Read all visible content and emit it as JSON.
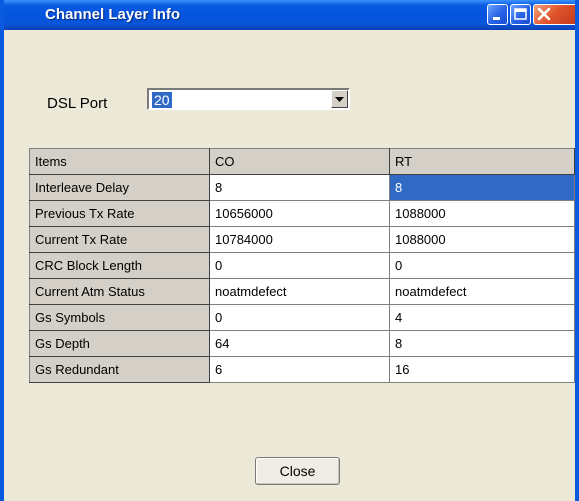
{
  "window": {
    "title": "Channel Layer Info",
    "controls": {
      "minimize": "minimize-icon",
      "maximize": "maximize-icon",
      "close": "close-icon"
    }
  },
  "port": {
    "label": "DSL Port",
    "selected": "20"
  },
  "table": {
    "columns": [
      "Items",
      "CO",
      "RT"
    ],
    "rows": [
      {
        "item": "Interleave Delay",
        "co": "8",
        "rt": "8"
      },
      {
        "item": "Previous Tx Rate",
        "co": "10656000",
        "rt": "1088000"
      },
      {
        "item": "Current Tx Rate",
        "co": "10784000",
        "rt": "1088000"
      },
      {
        "item": "CRC Block Length",
        "co": "0",
        "rt": "0"
      },
      {
        "item": "Current Atm Status",
        "co": "noatmdefect",
        "rt": "noatmdefect"
      },
      {
        "item": "Gs Symbols",
        "co": "0",
        "rt": "4"
      },
      {
        "item": "Gs Depth",
        "co": "64",
        "rt": "8"
      },
      {
        "item": "Gs Redundant",
        "co": "6",
        "rt": "16"
      }
    ]
  },
  "buttons": {
    "close_label": "Close"
  },
  "colors": {
    "title_bar": "#0a5ae0",
    "selection": "#316ac5",
    "dialog_bg": "#ece9d8"
  }
}
